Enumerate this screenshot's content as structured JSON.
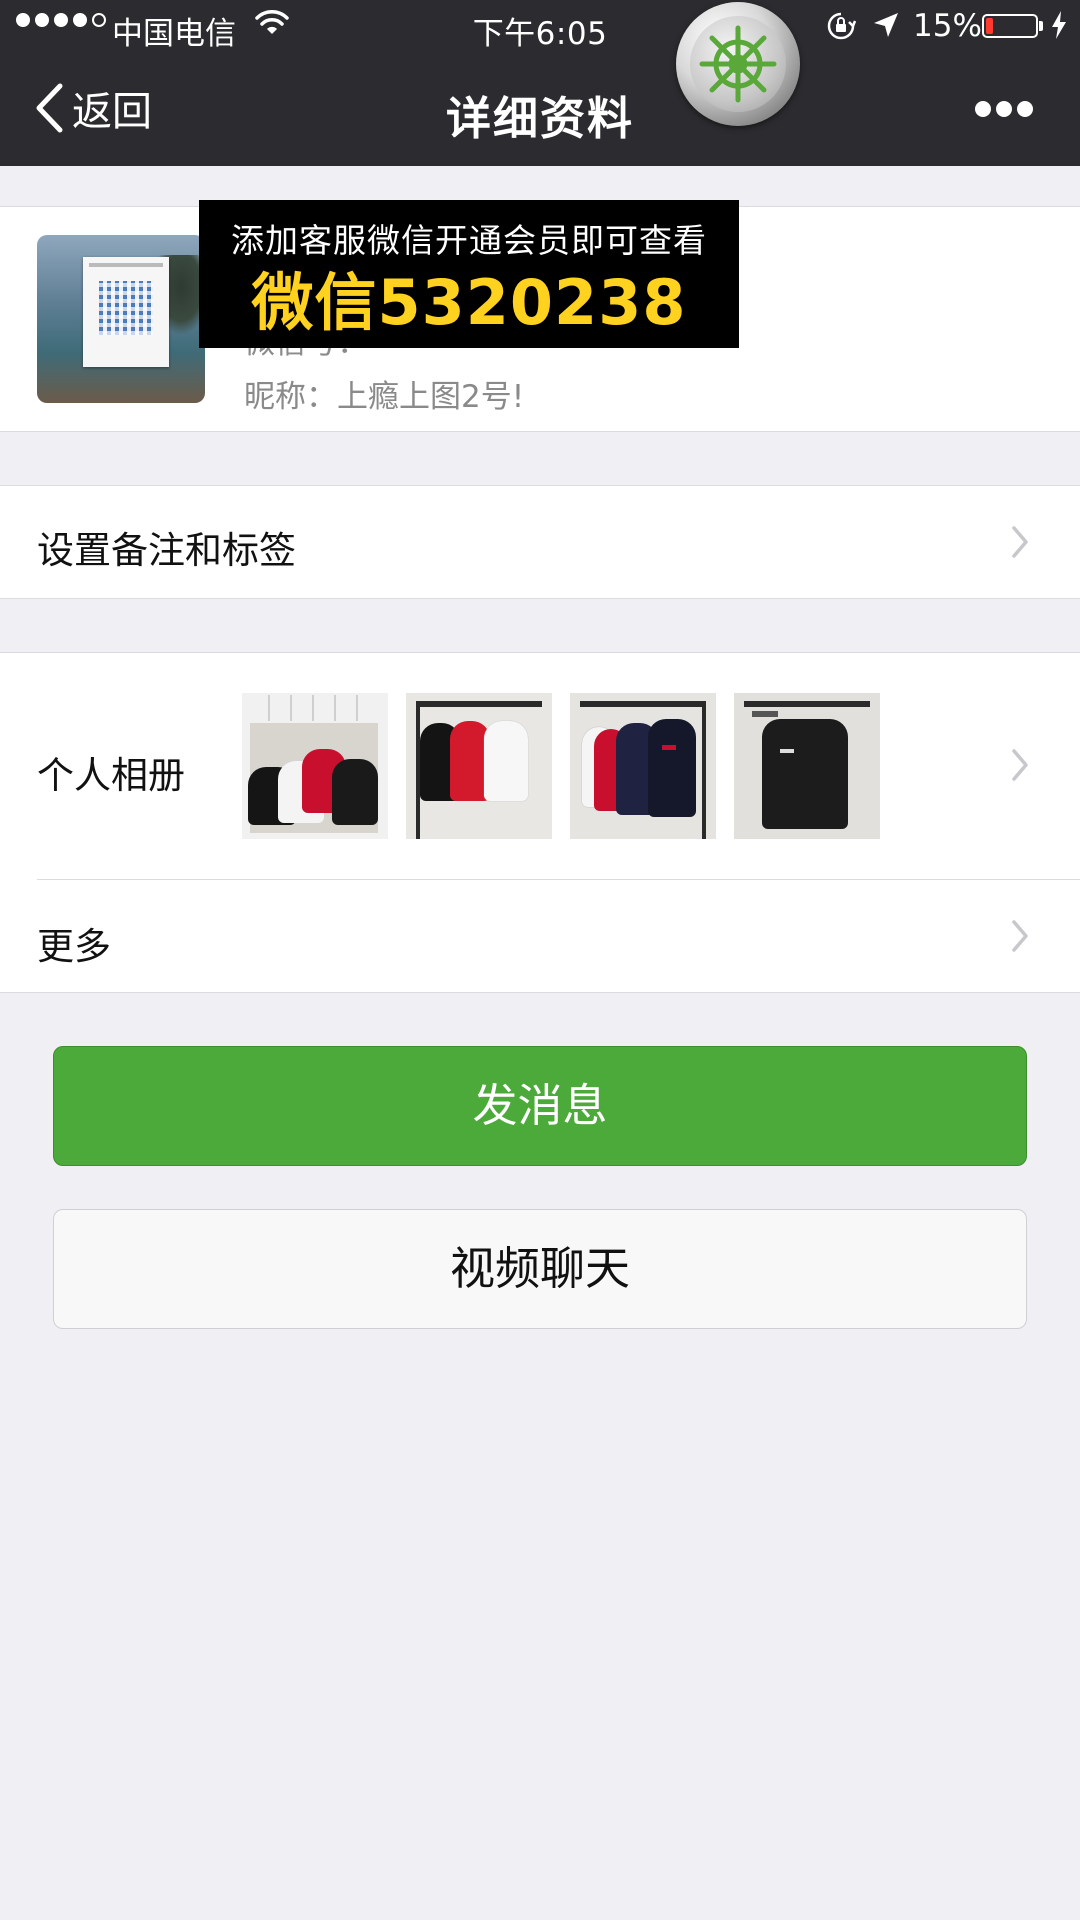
{
  "status_bar": {
    "signal_bars_filled": 4,
    "signal_bars_total": 5,
    "carrier": "中国电信",
    "time": "下午6:05",
    "battery_percent": "15%",
    "battery_level": 0.15,
    "battery_color": "#ff3b30"
  },
  "nav": {
    "back_label": "返回",
    "title": "详细资料"
  },
  "profile": {
    "wechat_id_partial": "微信号：",
    "nickname_label": "昵称：",
    "nickname": "上瘾上图2号!"
  },
  "promo_overlay": {
    "line1": "添加客服微信开通会员即可查看",
    "line2": "微信5320238"
  },
  "cells": {
    "remark_label": "设置备注和标签",
    "album_label": "个人相册",
    "more_label": "更多"
  },
  "buttons": {
    "send_message": "发消息",
    "video_chat": "视频聊天"
  },
  "colors": {
    "nav_bg": "#2c2c30",
    "accent_green": "#4caa3a",
    "promo_yellow": "#ffd21f",
    "page_bg": "#efeff4"
  },
  "icons": {
    "back": "chevron-left-icon",
    "more": "ellipsis-icon",
    "floating_badge": "ship-wheel-icon",
    "cell_arrow": "chevron-right-icon",
    "wifi": "wifi-icon",
    "rotation_lock": "rotation-lock-icon",
    "location": "location-arrow-icon",
    "battery": "battery-icon",
    "charging": "charging-bolt-icon"
  }
}
